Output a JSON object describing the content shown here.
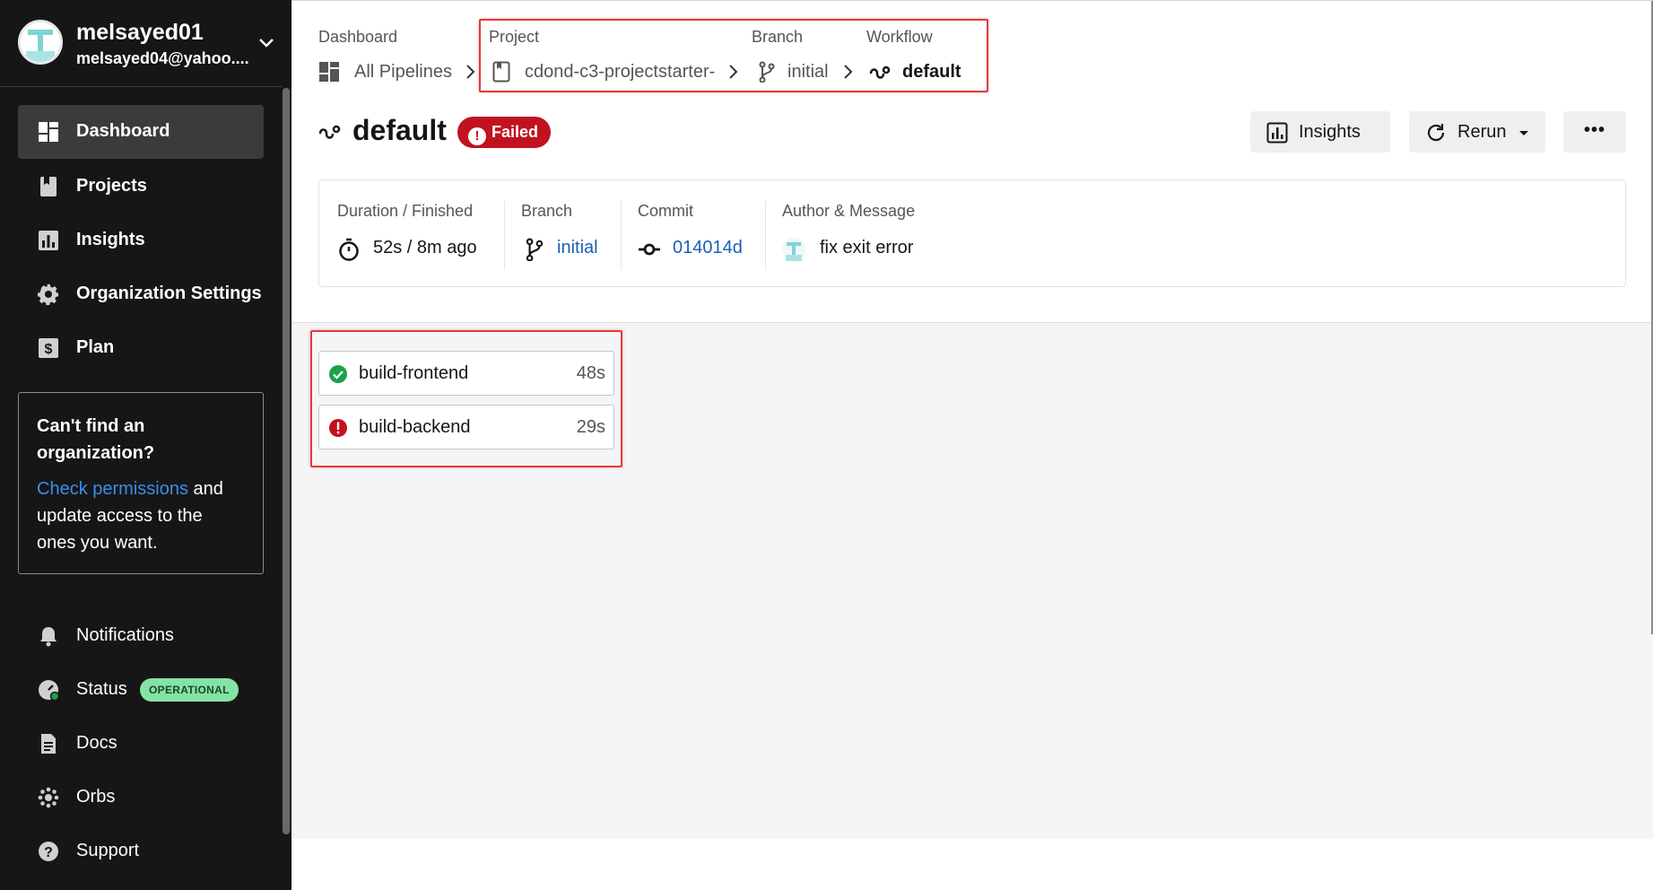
{
  "sidebar": {
    "user": {
      "name": "melsayed01",
      "email": "melsayed04@yahoo...."
    },
    "nav": [
      {
        "label": "Dashboard"
      },
      {
        "label": "Projects"
      },
      {
        "label": "Insights"
      },
      {
        "label": "Organization Settings"
      },
      {
        "label": "Plan"
      }
    ],
    "org_prompt": {
      "title": "Can't find an organization?",
      "link": "Check permissions",
      "rest": " and update access to the ones you want."
    },
    "footer_nav": [
      {
        "label": "Notifications"
      },
      {
        "label": "Status",
        "badge": "OPERATIONAL"
      },
      {
        "label": "Docs"
      },
      {
        "label": "Orbs"
      },
      {
        "label": "Support"
      }
    ]
  },
  "breadcrumb": {
    "dashboard": {
      "label": "Dashboard",
      "value": "All Pipelines"
    },
    "project": {
      "label": "Project",
      "value": "cdond-c3-projectstarter-"
    },
    "branch": {
      "label": "Branch",
      "value": "initial"
    },
    "workflow": {
      "label": "Workflow",
      "value": "default"
    }
  },
  "workflow": {
    "name": "default",
    "status": "Failed",
    "status_color": "#c1121f",
    "actions": {
      "insights": "Insights",
      "rerun": "Rerun",
      "more": "•••"
    }
  },
  "summary": {
    "duration": {
      "label": "Duration / Finished",
      "value": "52s / 8m ago"
    },
    "branch": {
      "label": "Branch",
      "value": "initial"
    },
    "commit": {
      "label": "Commit",
      "value": "014014d"
    },
    "author": {
      "label": "Author & Message",
      "value": "fix exit error"
    }
  },
  "jobs": [
    {
      "name": "build-frontend",
      "duration": "48s",
      "status": "success",
      "color": "#1aa34a"
    },
    {
      "name": "build-backend",
      "duration": "29s",
      "status": "failed",
      "color": "#c1121f"
    }
  ],
  "colors": {
    "sidebar_bg": "#161616",
    "link": "#1a5fb4",
    "highlight": "#e23b3b",
    "operational": "#85e3a5"
  }
}
